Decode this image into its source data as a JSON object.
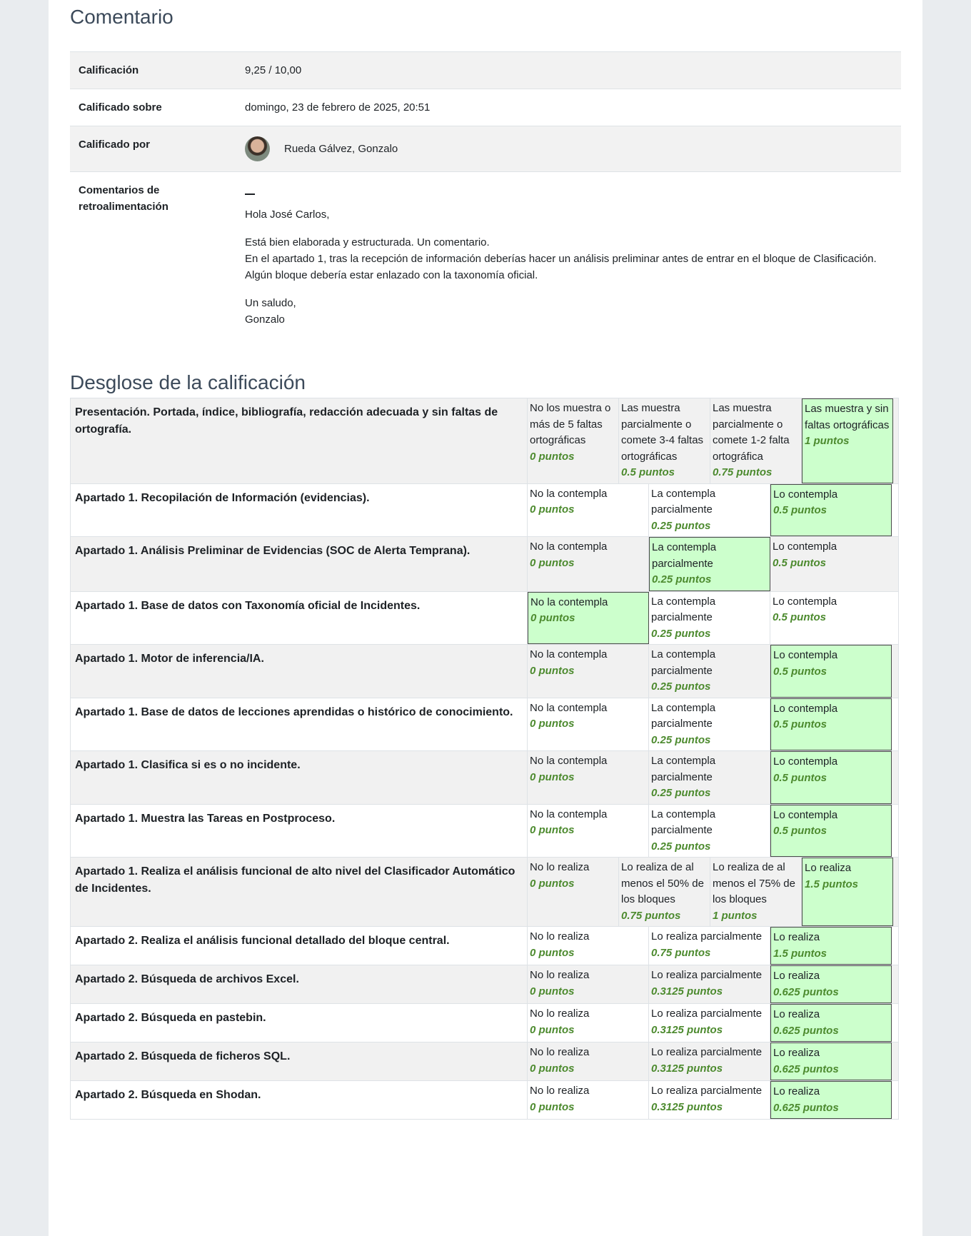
{
  "feedback": {
    "title": "Comentario",
    "rows": {
      "grade_label": "Calificación",
      "grade_value": "9,25 / 10,00",
      "graded_on_label": "Calificado sobre",
      "graded_on_value": "domingo, 23 de febrero de 2025, 20:51",
      "graded_by_label": "Calificado por",
      "graded_by_value": "Rueda Gálvez, Gonzalo",
      "comments_label_1": "Comentarios de",
      "comments_label_2": "retroalimentación"
    },
    "comments": {
      "greeting": "Hola José Carlos,",
      "line1": "Está bien elaborada y estructurada. Un comentario.",
      "line2": "En el apartado 1, tras la recepción de información deberías hacer un análisis preliminar antes de entrar en el bloque de Clasificación. Algún bloque debería estar enlazado con la taxonomía oficial.",
      "closing": "Un saludo,",
      "signature": "Gonzalo"
    }
  },
  "breakdown": {
    "title": "Desglose de la calificación",
    "criteria": [
      {
        "description": "Presentación. Portada, índice, bibliografía, redacción adecuada y sin faltas de ortografía.",
        "levels": [
          {
            "text": "No los muestra o más de 5 faltas ortográficas",
            "points": "0 puntos"
          },
          {
            "text": "Las muestra parcialmente o comete 3-4 faltas ortográficas",
            "points": "0.5 puntos"
          },
          {
            "text": "Las muestra parcialmente o comete 1-2 falta ortográfica",
            "points": "0.75 puntos"
          },
          {
            "text": "Las muestra y sin faltas ortográficas",
            "points": "1 puntos",
            "selected": true
          }
        ]
      },
      {
        "description": "Apartado 1. Recopilación de Información (evidencias).",
        "levels": [
          {
            "text": "No la contempla",
            "points": "0 puntos"
          },
          {
            "text": "La contempla parcialmente",
            "points": "0.25 puntos"
          },
          {
            "text": "Lo contempla",
            "points": "0.5 puntos",
            "selected": true
          }
        ]
      },
      {
        "description": "Apartado 1. Análisis Preliminar de Evidencias (SOC de Alerta Temprana).",
        "levels": [
          {
            "text": "No la contempla",
            "points": "0 puntos"
          },
          {
            "text": "La contempla parcialmente",
            "points": "0.25 puntos",
            "selected": true
          },
          {
            "text": "Lo contempla",
            "points": "0.5 puntos"
          }
        ]
      },
      {
        "description": "Apartado 1. Base de datos con Taxonomía oficial de Incidentes.",
        "levels": [
          {
            "text": "No la contempla",
            "points": "0 puntos",
            "selected": true
          },
          {
            "text": "La contempla parcialmente",
            "points": "0.25 puntos"
          },
          {
            "text": "Lo contempla",
            "points": "0.5 puntos"
          }
        ]
      },
      {
        "description": "Apartado 1. Motor de inferencia/IA.",
        "levels": [
          {
            "text": "No la contempla",
            "points": "0 puntos"
          },
          {
            "text": "La contempla parcialmente",
            "points": "0.25 puntos"
          },
          {
            "text": "Lo contempla",
            "points": "0.5 puntos",
            "selected": true
          }
        ]
      },
      {
        "description": "Apartado 1. Base de datos de lecciones aprendidas o histórico de conocimiento.",
        "levels": [
          {
            "text": "No la contempla",
            "points": "0 puntos"
          },
          {
            "text": "La contempla parcialmente",
            "points": "0.25 puntos"
          },
          {
            "text": "Lo contempla",
            "points": "0.5 puntos",
            "selected": true
          }
        ]
      },
      {
        "description": "Apartado 1. Clasifica si es o no incidente.",
        "levels": [
          {
            "text": "No la contempla",
            "points": "0 puntos"
          },
          {
            "text": "La contempla parcialmente",
            "points": "0.25 puntos"
          },
          {
            "text": "Lo contempla",
            "points": "0.5 puntos",
            "selected": true
          }
        ]
      },
      {
        "description": "Apartado 1. Muestra las Tareas en Postproceso.",
        "levels": [
          {
            "text": "No la contempla",
            "points": "0 puntos"
          },
          {
            "text": "La contempla parcialmente",
            "points": "0.25 puntos"
          },
          {
            "text": "Lo contempla",
            "points": "0.5 puntos",
            "selected": true
          }
        ]
      },
      {
        "description": "Apartado 1. Realiza el análisis funcional de alto nivel del Clasificador Automático de Incidentes.",
        "levels": [
          {
            "text": "No lo realiza",
            "points": "0 puntos"
          },
          {
            "text": "Lo realiza de al menos el 50% de los bloques",
            "points": "0.75 puntos"
          },
          {
            "text": "Lo realiza de al menos el 75% de los bloques",
            "points": "1 puntos"
          },
          {
            "text": "Lo realiza",
            "points": "1.5 puntos",
            "selected": true
          }
        ]
      },
      {
        "description": "Apartado 2. Realiza el análisis funcional detallado del bloque central.",
        "levels": [
          {
            "text": "No lo realiza",
            "points": "0 puntos"
          },
          {
            "text": "Lo realiza parcialmente",
            "points": "0.75 puntos"
          },
          {
            "text": "Lo realiza",
            "points": "1.5 puntos",
            "selected": true
          }
        ]
      },
      {
        "description": "Apartado 2. Búsqueda de archivos Excel.",
        "levels": [
          {
            "text": "No lo realiza",
            "points": "0 puntos"
          },
          {
            "text": "Lo realiza parcialmente",
            "points": "0.3125 puntos"
          },
          {
            "text": "Lo realiza",
            "points": "0.625 puntos",
            "selected": true
          }
        ]
      },
      {
        "description": "Apartado 2. Búsqueda en pastebin.",
        "levels": [
          {
            "text": "No lo realiza",
            "points": "0 puntos"
          },
          {
            "text": "Lo realiza parcialmente",
            "points": "0.3125 puntos"
          },
          {
            "text": "Lo realiza",
            "points": "0.625 puntos",
            "selected": true
          }
        ]
      },
      {
        "description": "Apartado 2. Búsqueda de ficheros SQL.",
        "levels": [
          {
            "text": "No lo realiza",
            "points": "0 puntos"
          },
          {
            "text": "Lo realiza parcialmente",
            "points": "0.3125 puntos"
          },
          {
            "text": "Lo realiza",
            "points": "0.625 puntos",
            "selected": true
          }
        ]
      },
      {
        "description": "Apartado 2. Búsqueda en Shodan.",
        "levels": [
          {
            "text": "No lo realiza",
            "points": "0 puntos"
          },
          {
            "text": "Lo realiza parcialmente",
            "points": "0.3125 puntos"
          },
          {
            "text": "Lo realiza",
            "points": "0.625 puntos",
            "selected": true
          }
        ]
      }
    ]
  }
}
